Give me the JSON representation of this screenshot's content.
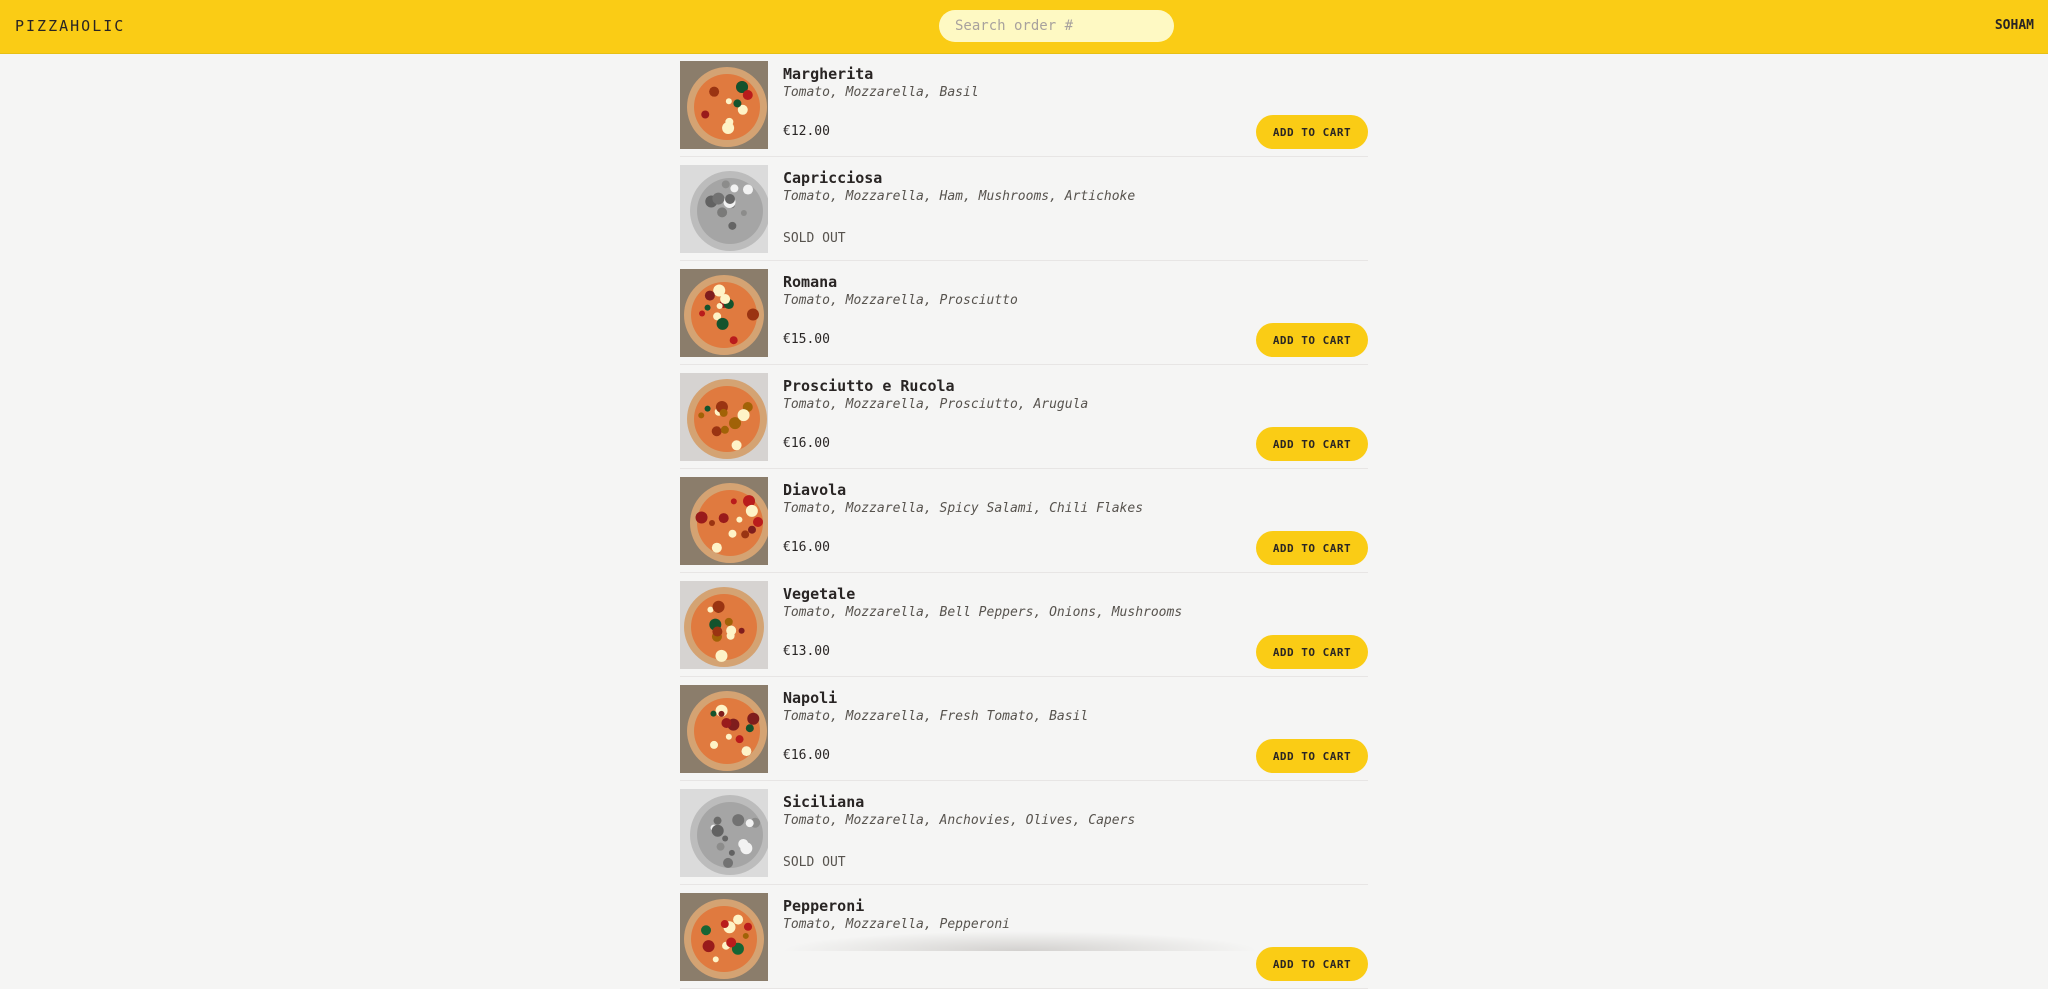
{
  "header": {
    "brand": "PIZZAHOLIC",
    "search_placeholder": "Search order #",
    "user_name": "SOHAM",
    "accent_color": "#facc15"
  },
  "menu": {
    "add_to_cart_label": "ADD TO CART",
    "sold_out_label": "SOLD OUT",
    "items": [
      {
        "name": "Margherita",
        "ingredients": "Tomato, Mozzarella, Basil",
        "price": "€12.00",
        "sold_out": false
      },
      {
        "name": "Capricciosa",
        "ingredients": "Tomato, Mozzarella, Ham, Mushrooms, Artichoke",
        "price": "",
        "sold_out": true
      },
      {
        "name": "Romana",
        "ingredients": "Tomato, Mozzarella, Prosciutto",
        "price": "€15.00",
        "sold_out": false
      },
      {
        "name": "Prosciutto e Rucola",
        "ingredients": "Tomato, Mozzarella, Prosciutto, Arugula",
        "price": "€16.00",
        "sold_out": false
      },
      {
        "name": "Diavola",
        "ingredients": "Tomato, Mozzarella, Spicy Salami, Chili Flakes",
        "price": "€16.00",
        "sold_out": false
      },
      {
        "name": "Vegetale",
        "ingredients": "Tomato, Mozzarella, Bell Peppers, Onions, Mushrooms",
        "price": "€13.00",
        "sold_out": false
      },
      {
        "name": "Napoli",
        "ingredients": "Tomato, Mozzarella, Fresh Tomato, Basil",
        "price": "€16.00",
        "sold_out": false
      },
      {
        "name": "Siciliana",
        "ingredients": "Tomato, Mozzarella, Anchovies, Olives, Capers",
        "price": "",
        "sold_out": true
      },
      {
        "name": "Pepperoni",
        "ingredients": "Tomato, Mozzarella, Pepperoni",
        "price": "",
        "sold_out": false
      }
    ]
  }
}
